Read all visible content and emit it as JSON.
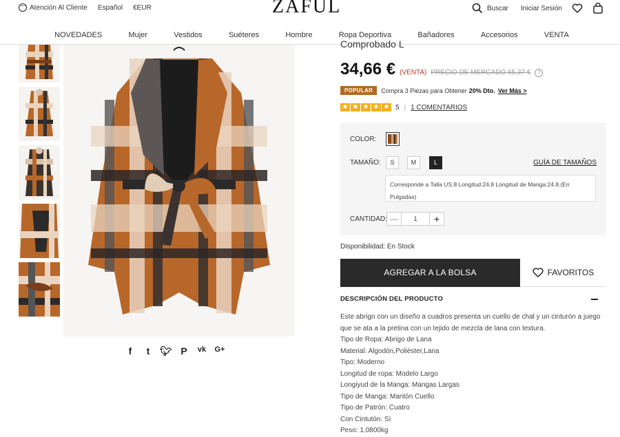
{
  "header": {
    "customer_service": "Atención Al Cliente",
    "language": "Español",
    "currency": "€EUR",
    "logo": "ZAFUL",
    "search": "Buscar",
    "login": "Iniciar Sesión"
  },
  "nav": [
    "NOVEDADES",
    "Mujer",
    "Vestidos",
    "Suéteres",
    "Hombre",
    "Ropa Deportiva",
    "Bañadores",
    "Accesorios",
    "VENTA"
  ],
  "product": {
    "title_fragment": "Comprobado L",
    "price": "34,66 €",
    "sale_label": "(VENTA)",
    "market_price": "PRECIO DE MERCADO 65,37 €",
    "promo_badge": "POPULAR",
    "promo_text": "Compra 3 Piezas para Obtener",
    "promo_discount": "20% Dto.",
    "promo_link": "Ver Más >",
    "rating": 5,
    "rating_label": "5",
    "comments_link": "1 COMENTARIOS",
    "color_label": "COLOR:",
    "size_label": "TAMAÑO:",
    "sizes": [
      "S",
      "M",
      "L"
    ],
    "selected_size": "L",
    "size_guide": "GUÍA DE TAMAÑOS",
    "size_info": "Corresponde a Talla US:8   Longitud:24.8   Longitud de Manga:24.8.(En Pulgadas)",
    "qty_label": "CANTIDAD:",
    "qty_value": "1",
    "availability": "Disponibilidad: En Stock",
    "add_to_bag": "AGREGAR A LA BOLSA",
    "favorites": "FAVORITOS",
    "description_heading": "DESCRIPCIÓN DEL PRODUCTO",
    "description_intro": "Este abrigo con un diseño a cuadros presenta un cuello de chal y un cinturón a juego que se ata a la pretina con un tejido de mezcla de lana con textura.",
    "specs": [
      "Tipo de Ropa: Abrigo de Lana",
      "Material: Algodón,Poliéster,Lana",
      "Tipo: Moderno",
      "Longitud de ropa: Modelo Largo",
      "Longiyud de la Manga: Mangas Largas",
      "Tipo de Manga: Mantón Cuello",
      "Tipo de Patrón: Cuatro",
      "Con Cintutón: Sí",
      "Peso: 1.0800kg"
    ]
  },
  "share_icons": [
    "facebook-icon",
    "tumblr-icon",
    "twitter-icon",
    "pinterest-icon",
    "vk-icon",
    "google-plus-icon"
  ],
  "colors": {
    "accent": "#b46a1e",
    "star": "#f2b01e",
    "dark_button": "#2a2a2a",
    "sale": "#c0392b"
  }
}
